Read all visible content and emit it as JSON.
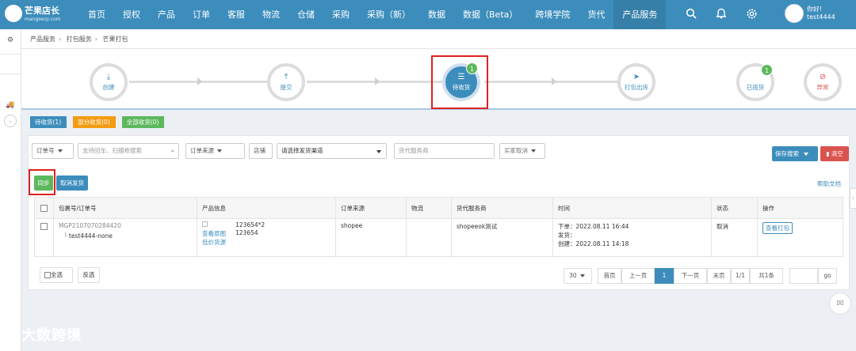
{
  "brand": {
    "title": "芒果店长",
    "subtitle": "mangoerp.com"
  },
  "nav": [
    "首页",
    "授权",
    "产品",
    "订单",
    "客服",
    "物流",
    "仓储",
    "采购",
    "采购（新）",
    "数据",
    "数据（Beta）",
    "跨境学院",
    "货代",
    "产品服务"
  ],
  "user": {
    "greeting": "你好!",
    "name": "test4444"
  },
  "breadcrumb": [
    "产品服务",
    "打包服务",
    "芒果打包"
  ],
  "steps": [
    {
      "label": "创建",
      "icon": "download-icon"
    },
    {
      "label": "提交",
      "icon": "upload-icon"
    },
    {
      "label": "待收货",
      "icon": "box-icon",
      "badge": "1"
    },
    {
      "label": "打包出库",
      "icon": "send-icon"
    },
    {
      "label": "已揽货",
      "icon": "",
      "badge": "1"
    },
    {
      "label": "异常",
      "icon": "eye-off-icon"
    }
  ],
  "status_tabs": [
    {
      "label": "待收货(1)",
      "color": "#3c8dbc"
    },
    {
      "label": "部分收货(0)",
      "color": "#f39c12"
    },
    {
      "label": "全部收货(0)",
      "color": "#5cb85c"
    }
  ],
  "filters": {
    "order_type": "订单号",
    "search_placeholder": "支持回车、扫描枪搜索",
    "order_source": "订单来源",
    "shop": "店铺",
    "channel": "请选择发货渠道",
    "forwarder": "货代服务商",
    "buyer_cancel": "买家取消",
    "save_search": "保存搜索",
    "clear": "清空"
  },
  "actions": {
    "sync": "同步",
    "cancel_ship": "取消发货",
    "help": "帮助文档"
  },
  "table": {
    "headers": [
      "包裹号/订单号",
      "产品信息",
      "订单来源",
      "物流",
      "货代服务商",
      "时间",
      "状态",
      "操作"
    ],
    "rows": [
      {
        "package_no": "MGP2107070284420",
        "order_no": "test4444-none",
        "product_links": [
          "查看原图",
          "低价货源"
        ],
        "sku1": "123654*2",
        "sku2": "123654",
        "source": "shopee",
        "logistics": "",
        "forwarder": "shopeeok测试",
        "time_order": "下单：2022.08.11 16:44",
        "time_ship": "发货：",
        "time_created": "创建：2022.08.11 14:18",
        "status": "取消",
        "op": "查看打包"
      }
    ]
  },
  "footer": {
    "select_all": "全选",
    "invert": "反选",
    "page_size": "30",
    "first": "首页",
    "prev": "上一页",
    "current": "1",
    "next": "下一页",
    "last": "末页",
    "pages": "1/1",
    "total": "共1条",
    "go": "go"
  },
  "watermark": "大数跨境"
}
